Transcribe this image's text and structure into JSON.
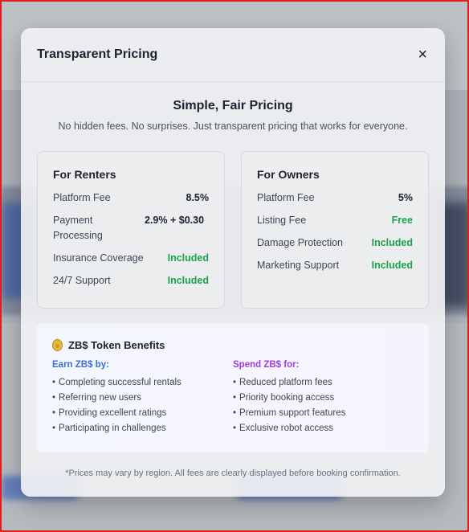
{
  "modal": {
    "title": "Transparent Pricing",
    "close_icon": "×",
    "hero_title": "Simple, Fair Pricing",
    "hero_subtitle": "No hidden fees. No surprises. Just transparent pricing that works for everyone."
  },
  "renters": {
    "title": "For Renters",
    "rows": [
      {
        "label": "Platform Fee",
        "value": "8.5%"
      },
      {
        "label": "Payment Processing",
        "value": "2.9% + $0.30"
      },
      {
        "label": "Insurance Coverage",
        "value": "Included"
      },
      {
        "label": "24/7 Support",
        "value": "Included"
      }
    ]
  },
  "owners": {
    "title": "For Owners",
    "rows": [
      {
        "label": "Platform Fee",
        "value": "5%"
      },
      {
        "label": "Listing Fee",
        "value": "Free"
      },
      {
        "label": "Damage Protection",
        "value": "Included"
      },
      {
        "label": "Marketing Support",
        "value": "Included"
      }
    ]
  },
  "token": {
    "icon": "coin-icon",
    "title": "ZB$ Token Benefits",
    "earn_heading": "Earn ZB$ by:",
    "earn_items": [
      "Completing successful rentals",
      "Referring new users",
      "Providing excellent ratings",
      "Participating in challenges"
    ],
    "spend_heading": "Spend ZB$ for:",
    "spend_items": [
      "Reduced platform fees",
      "Priority booking access",
      "Premium support features",
      "Exclusive robot access"
    ]
  },
  "footnote": "*Prices may vary by region. All fees are clearly displayed before booking confirmation.",
  "colors": {
    "included_green": "#1aa34a",
    "earn_blue": "#3b6fd6",
    "spend_purple": "#9b3fd6"
  }
}
